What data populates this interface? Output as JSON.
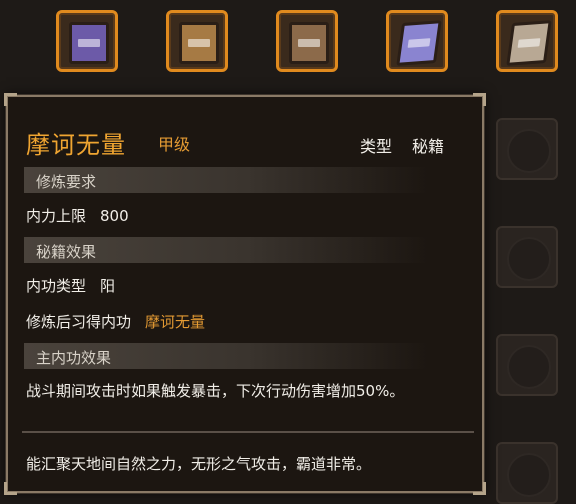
{
  "inventory": {
    "items": [
      {
        "name": "book-purple",
        "color": "#6c5aa8"
      },
      {
        "name": "book-tan",
        "color": "#a67a44"
      },
      {
        "name": "book-brown",
        "color": "#8c6a4a"
      },
      {
        "name": "book-lavender",
        "color": "#8a84d0"
      },
      {
        "name": "book-grey",
        "color": "#b8a894"
      }
    ]
  },
  "tooltip": {
    "title": "摩诃无量",
    "grade": "甲级",
    "type_label": "类型",
    "type_value": "秘籍",
    "sections": {
      "requirements": "修炼要求",
      "effects": "秘籍效果",
      "main_effect": "主内功效果"
    },
    "requirements": {
      "label": "内力上限",
      "value": "800"
    },
    "effects": {
      "neigong_type_label": "内功类型",
      "neigong_type_value": "阳",
      "learned_label": "修炼后习得内功",
      "learned_value": "摩诃无量"
    },
    "main_effect_text": "战斗期间攻击时如果触发暴击，下次行动伤害增加50%。",
    "flavor_text": "能汇聚天地间自然之力，无形之气攻击，霸道非常。"
  }
}
